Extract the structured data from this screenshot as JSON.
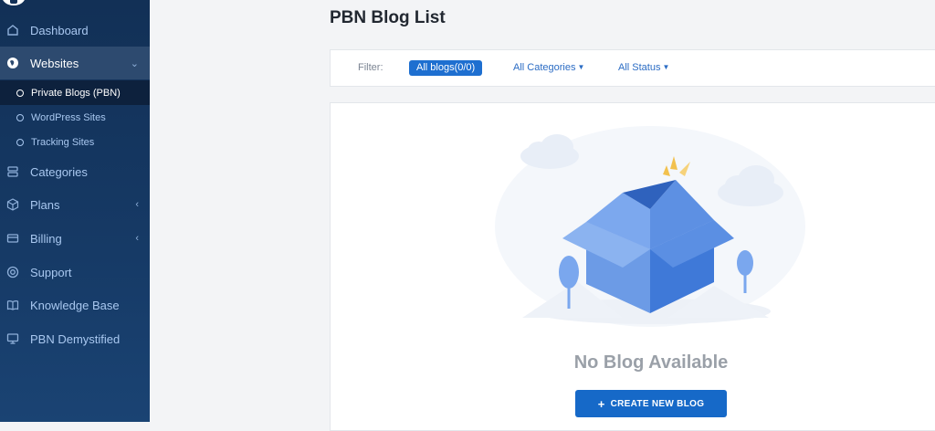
{
  "sidebar": {
    "items": [
      {
        "label": "Dashboard",
        "icon": "home-icon"
      },
      {
        "label": "Websites",
        "icon": "globe-icon"
      },
      {
        "label": "Categories",
        "icon": "stack-icon"
      },
      {
        "label": "Plans",
        "icon": "cube-icon"
      },
      {
        "label": "Billing",
        "icon": "card-icon"
      },
      {
        "label": "Support",
        "icon": "lifebuoy-icon"
      },
      {
        "label": "Knowledge Base",
        "icon": "book-icon"
      },
      {
        "label": "PBN Demystified",
        "icon": "monitor-icon"
      }
    ],
    "submenu": [
      {
        "label": "Private Blogs (PBN)"
      },
      {
        "label": "WordPress Sites"
      },
      {
        "label": "Tracking Sites"
      }
    ]
  },
  "page": {
    "title": "PBN Blog List"
  },
  "filter": {
    "label": "Filter:",
    "all_blogs": "All blogs(0/0)",
    "categories": "All Categories",
    "status": "All Status"
  },
  "empty": {
    "title": "No Blog Available",
    "button": "CREATE NEW BLOG"
  },
  "colors": {
    "sidebar_bg": "#123056",
    "accent": "#1e6fd0",
    "button": "#1669c8"
  }
}
